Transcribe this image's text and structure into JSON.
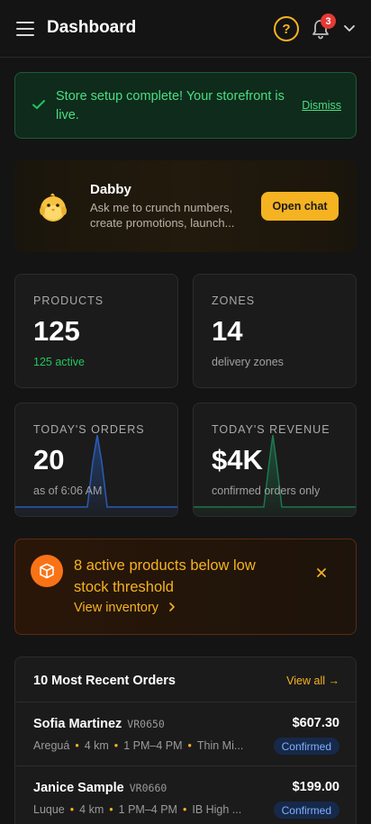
{
  "header": {
    "title": "Dashboard",
    "notification_count": "3"
  },
  "banner": {
    "message": "Store setup complete! Your storefront is live.",
    "dismiss_label": "Dismiss"
  },
  "assistant": {
    "name": "Dabby",
    "description": "Ask me to crunch numbers, create promotions, launch...",
    "button_label": "Open chat"
  },
  "stats": [
    {
      "label": "PRODUCTS",
      "value": "125",
      "sub": "125 active"
    },
    {
      "label": "ZONES",
      "value": "14",
      "sub": "delivery zones"
    },
    {
      "label": "TODAY'S ORDERS",
      "value": "20",
      "sub": "as of 6:06 AM"
    },
    {
      "label": "TODAY'S REVENUE",
      "value": "$4K",
      "sub": "confirmed orders only"
    }
  ],
  "low_stock_alert": {
    "title": "8 active products below low stock threshold",
    "link_label": "View inventory"
  },
  "recent_orders": {
    "title": "10 Most Recent Orders",
    "view_all_label": "View all →",
    "rows": [
      {
        "customer": "Sofia Martinez",
        "code": "VR0650",
        "location": "Areguá",
        "distance": "4 km",
        "window": "1 PM–4 PM",
        "item": "Thin Mi...",
        "amount": "$607.30",
        "status": "Confirmed"
      },
      {
        "customer": "Janice Sample",
        "code": "VR0660",
        "location": "Luque",
        "distance": "4 km",
        "window": "1 PM–4 PM",
        "item": "IB High ...",
        "amount": "$199.00",
        "status": "Confirmed"
      }
    ]
  },
  "colors": {
    "accent": "#f5b321",
    "success": "#4ade80",
    "warning": "#f97316",
    "status_badge_bg": "#16294a",
    "status_badge_text": "#7fb0ff"
  },
  "icons": [
    "menu-icon",
    "help-icon",
    "bell-icon",
    "chevron-down-icon",
    "check-icon",
    "chick-avatar-icon",
    "box-icon",
    "close-icon",
    "chevron-right-icon"
  ]
}
